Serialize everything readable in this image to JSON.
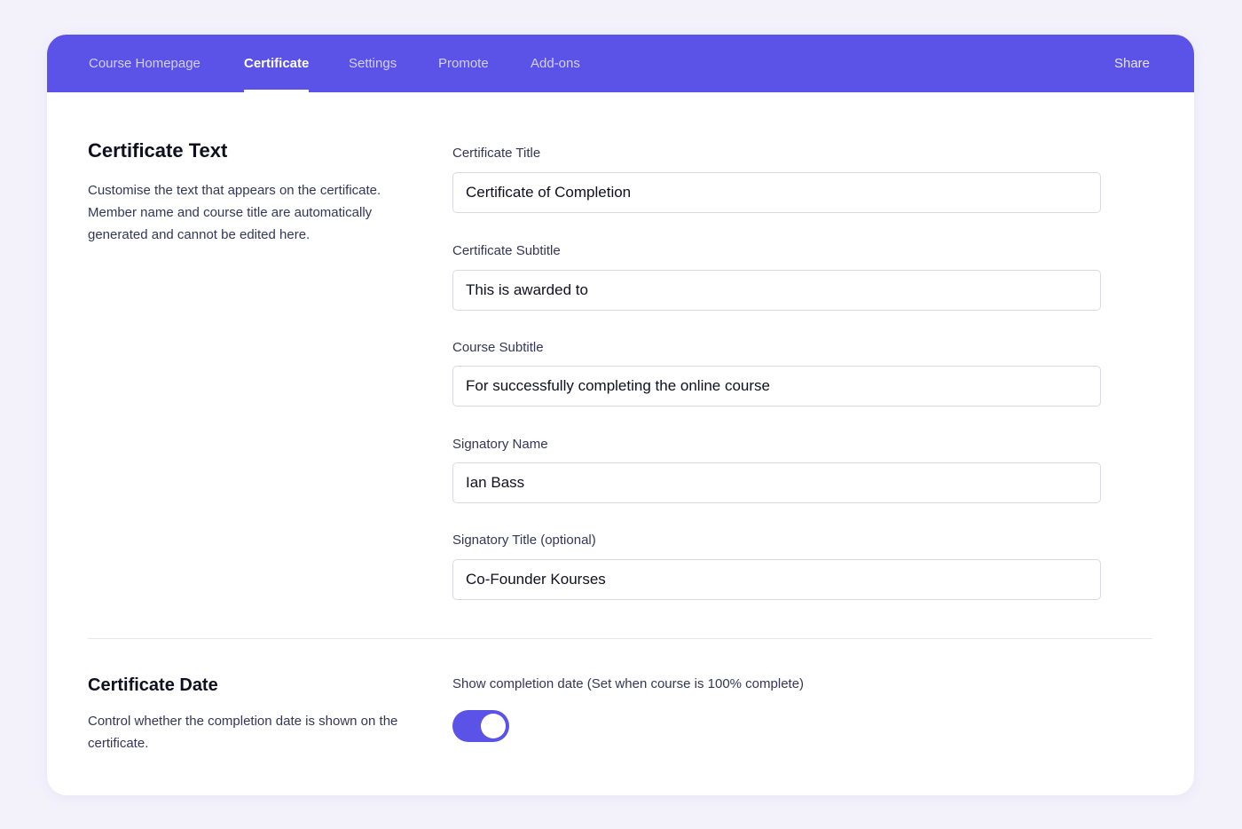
{
  "nav": {
    "tabs": [
      {
        "label": "Course Homepage",
        "active": false
      },
      {
        "label": "Certificate",
        "active": true
      },
      {
        "label": "Settings",
        "active": false
      },
      {
        "label": "Promote",
        "active": false
      },
      {
        "label": "Add-ons",
        "active": false
      }
    ],
    "share_label": "Share"
  },
  "certificate_text": {
    "title": "Certificate Text",
    "description": "Customise the text that appears on the certificate. Member name and course title are automatically generated and cannot be edited here.",
    "fields": [
      {
        "label": "Certificate Title",
        "value": "Certificate of Completion"
      },
      {
        "label": "Certificate Subtitle",
        "value": "This is awarded to"
      },
      {
        "label": "Course Subtitle",
        "value": "For successfully completing the online course"
      },
      {
        "label": "Signatory Name",
        "value": "Ian Bass"
      },
      {
        "label": "Signatory Title (optional)",
        "value": "Co-Founder Kourses"
      }
    ]
  },
  "certificate_date": {
    "title": "Certificate Date",
    "description": "Control whether the completion date is shown on the certificate.",
    "toggle_label": "Show completion date (Set when course is 100% complete)",
    "toggle_on": true
  },
  "colors": {
    "accent": "#5b52e8",
    "background": "#f3f2fb"
  }
}
